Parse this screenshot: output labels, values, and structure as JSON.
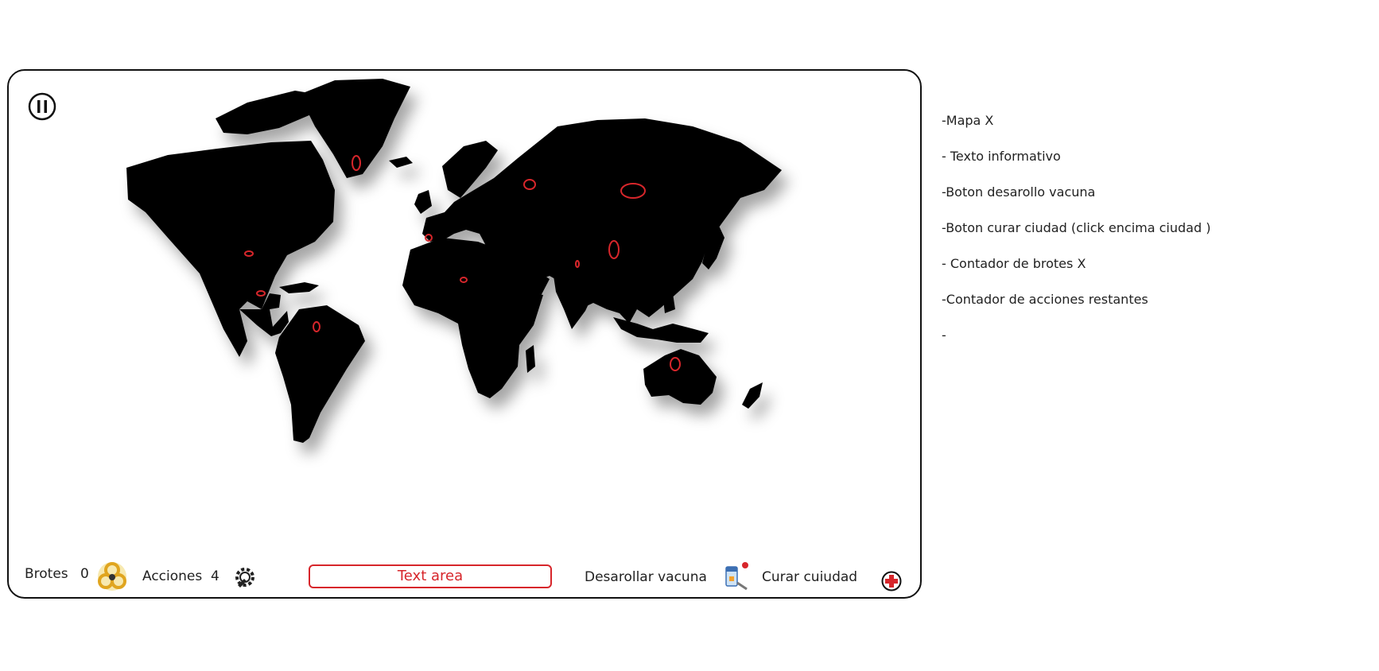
{
  "status_bar": {
    "outbreaks_label": "Brotes",
    "outbreaks_count": "0",
    "actions_label": "Acciones",
    "actions_count": "4"
  },
  "text_area": {
    "label": "Text area"
  },
  "actions": {
    "develop_vaccine_label": "Desarollar vacuna",
    "cure_city_label": "Curar cuiudad"
  },
  "notes": [
    "-Mapa X",
    "- Texto informativo",
    "-Boton desarollo vacuna",
    "-Boton curar ciudad (click encima ciudad )",
    "- Contador de brotes X",
    "-Contador de acciones restantes",
    "-"
  ],
  "icons": {
    "pause": "pause-icon",
    "outbreaks": "biohazard-icon",
    "actions": "settings-wrench-icon",
    "vaccine": "vaccine-vial-icon",
    "cure": "red-cross-icon"
  },
  "colors": {
    "accent_red": "#d7262b",
    "map_fill": "#000000",
    "biohazard_yellow": "#f2c230"
  },
  "outbreak_markers": [
    "Greenland",
    "North America",
    "Central America",
    "South America",
    "Western Europe",
    "North Africa",
    "Russia West",
    "Russia East",
    "China",
    "India",
    "Australia"
  ]
}
